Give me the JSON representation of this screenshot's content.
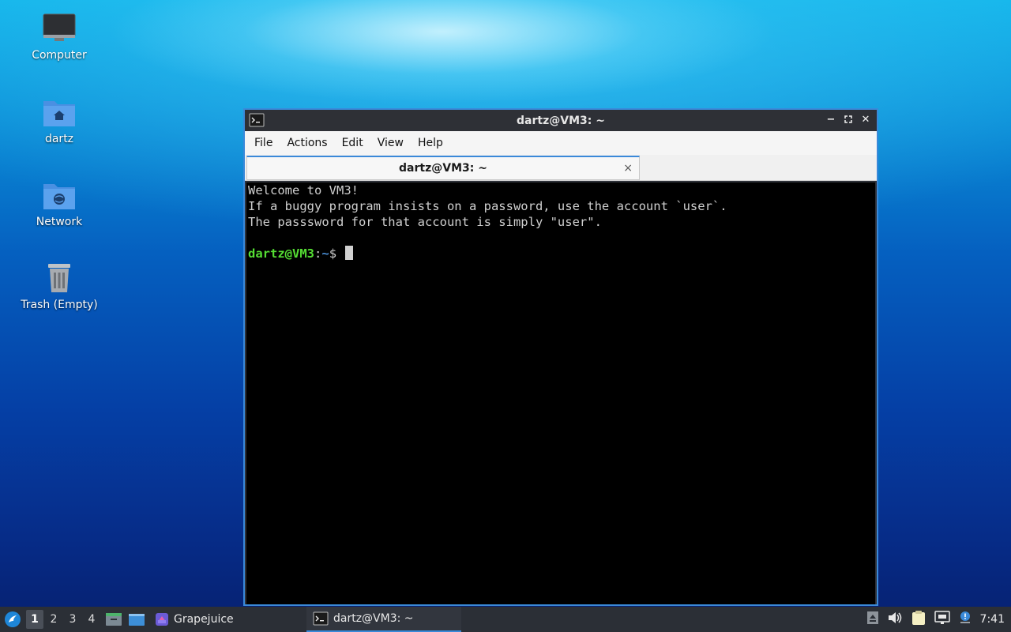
{
  "desktop": {
    "icons": [
      {
        "label": "Computer"
      },
      {
        "label": "dartz"
      },
      {
        "label": "Network"
      },
      {
        "label": "Trash (Empty)"
      }
    ]
  },
  "window": {
    "title": "dartz@VM3: ~",
    "menu": [
      "File",
      "Actions",
      "Edit",
      "View",
      "Help"
    ],
    "tab_label": "dartz@VM3: ~",
    "tab_close": "×",
    "terminal": {
      "lines": [
        "Welcome to VM3!",
        "If a buggy program insists on a password, use the account `user`.",
        "The passsword for that account is simply \"user\"."
      ],
      "prompt_user": "dartz@VM3",
      "prompt_sep": ":",
      "prompt_path": "~",
      "prompt_symbol": "$"
    }
  },
  "taskbar": {
    "workspaces": [
      "1",
      "2",
      "3",
      "4"
    ],
    "active_workspace": "1",
    "grapejuice_label": "Grapejuice",
    "terminal_task_label": "dartz@VM3: ~",
    "clock": "7:41"
  },
  "colors": {
    "accent": "#3a89d9",
    "prompt_user": "#55dd33",
    "prompt_path": "#4a8fd6"
  }
}
